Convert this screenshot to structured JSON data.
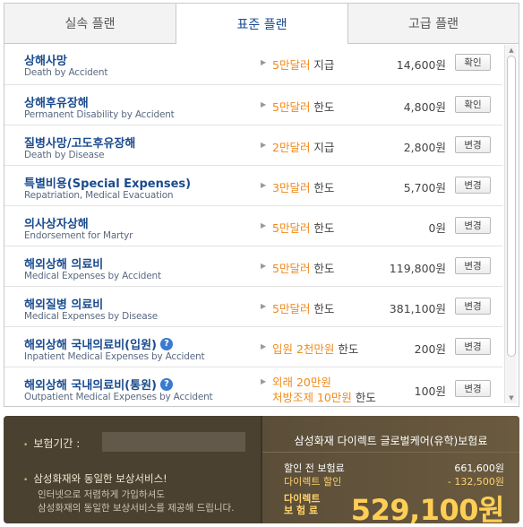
{
  "tabs": [
    {
      "label": "실속 플랜",
      "active": false
    },
    {
      "label": "표준 플랜",
      "active": true
    },
    {
      "label": "고급 플랜",
      "active": false
    }
  ],
  "coverages": [
    {
      "name_ko": "상해사망",
      "name_en": "Death by Accident",
      "limit_amount": "5만달러",
      "limit_suffix": " 지급",
      "premium": "14,600원",
      "button": "확인"
    },
    {
      "name_ko": "상해후유장해",
      "name_en": "Permanent Disability by Accident",
      "limit_amount": "5만달러",
      "limit_suffix": " 한도",
      "premium": "4,800원",
      "button": "확인"
    },
    {
      "name_ko": "질병사망/고도후유장해",
      "name_en": "Death by Disease",
      "limit_amount": "2만달러",
      "limit_suffix": " 지급",
      "premium": "2,800원",
      "button": "변경"
    },
    {
      "name_ko": "특별비용(Special Expenses)",
      "name_en": "Repatriation, Medical Evacuation",
      "limit_amount": "3만달러",
      "limit_suffix": " 한도",
      "premium": "5,700원",
      "button": "변경"
    },
    {
      "name_ko": "의사상자상해",
      "name_en": "Endorsement for Martyr",
      "limit_amount": "5만달러",
      "limit_suffix": " 한도",
      "premium": "0원",
      "button": "변경"
    },
    {
      "name_ko": "해외상해 의료비",
      "name_en": "Medical Expenses by Accident",
      "limit_amount": "5만달러",
      "limit_suffix": " 한도",
      "premium": "119,800원",
      "button": "변경"
    },
    {
      "name_ko": "해외질병 의료비",
      "name_en": "Medical Expenses by Disease",
      "limit_amount": "5만달러",
      "limit_suffix": " 한도",
      "premium": "381,100원",
      "button": "변경"
    },
    {
      "name_ko": "해외상해 국내의료비(입원)",
      "name_en": "Inpatient Medical Expenses by Accident",
      "limit_amount": "입원 2천만원",
      "limit_suffix": " 한도",
      "premium": "200원",
      "button": "변경",
      "help": "?"
    },
    {
      "name_ko": "해외상해 국내의료비(통원)",
      "name_en": "Outpatient Medical Expenses by Accident",
      "limit_line1": "외래 20만원",
      "limit_line2_amount": "처방조제 10만원",
      "limit_line2_suffix": " 한도",
      "premium": "100원",
      "button": "변경",
      "help": "?"
    }
  ],
  "summary": {
    "period_label": "보험기간 :",
    "service_title": "삼성화재와 동일한 보상서비스!",
    "service_desc_1": "인터넷으로 저렴하게 가입하셔도",
    "service_desc_2": "삼성화재의 동일한 보상서비스를 제공해 드립니다.",
    "product_name": "삼성화재 다이렉트 글로벌케어(유학)보험료",
    "before_label": "할인 전 보험료",
    "before_value": "661,600원",
    "discount_label": "다이렉트 할인",
    "discount_value": "- 132,500원",
    "final_label_1": "다이렉트",
    "final_label_2": "보 험 료",
    "final_value": "529,100원"
  },
  "icons": {
    "bullet": "bullet-dot-icon",
    "arrow": "small-triangle-arrow-icon",
    "help": "question-circle-icon"
  },
  "colors": {
    "accent_blue": "#1a4b8e",
    "limit_orange": "#f08a1c",
    "summary_bg": "#4b4131",
    "final_gold": "#ffcf55"
  }
}
